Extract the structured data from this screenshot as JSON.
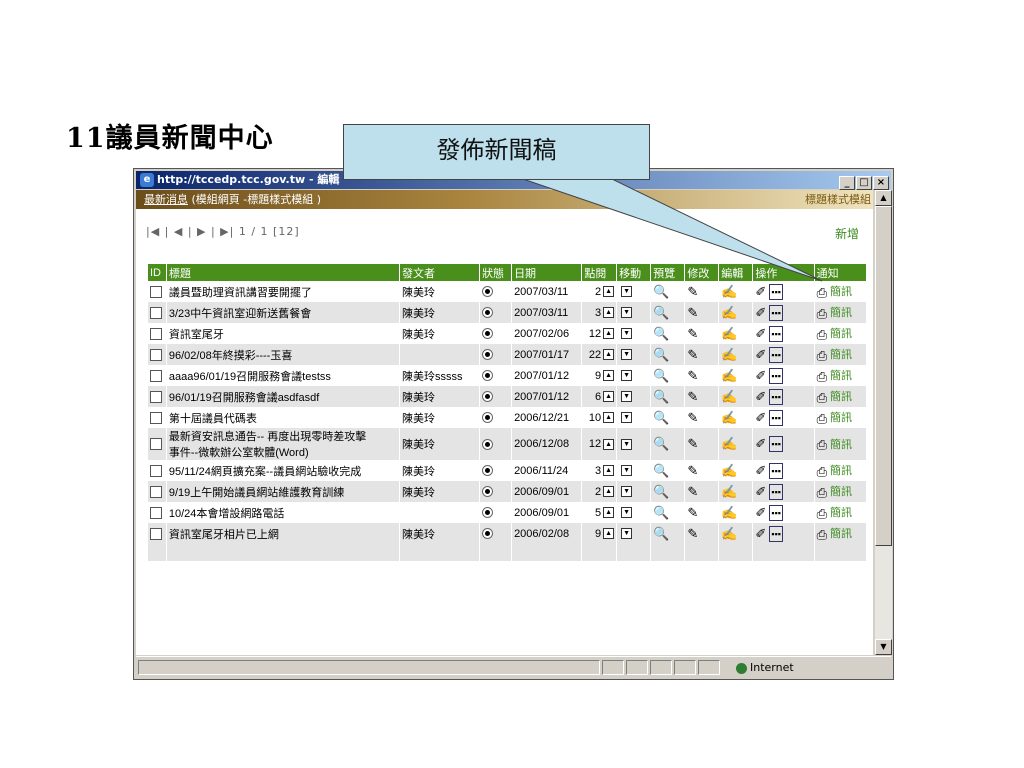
{
  "slide": {
    "title": "11議員新聞中心",
    "callout": "發佈新聞稿"
  },
  "window": {
    "title": "http://tccedp.tcc.gov.tw - 編輯",
    "ie_icon": "e",
    "buttons": [
      "_",
      "□",
      "×"
    ]
  },
  "banner": {
    "link": "最新消息",
    "subtitle": "(模組網頁 -標題樣式模組 )",
    "right": "標題樣式模組"
  },
  "toolbar": {
    "pager": "|◀ | ◀ | ▶ | ▶|   1 / 1  [12]",
    "add_label": "新增"
  },
  "table": {
    "headers": [
      "ID",
      "標題",
      "發文者",
      "狀態",
      "日期",
      "點閱",
      "移動",
      "預覽",
      "修改",
      "編輯",
      "操作",
      "通知"
    ],
    "sms_label": "簡訊",
    "rows": [
      {
        "title": "議員暨助理資訊講習要開擺了",
        "author": "陳美玲",
        "date": "2007/03/11",
        "clicks": "2"
      },
      {
        "title": "3/23中午資訊室迎新送舊餐會",
        "author": "陳美玲",
        "date": "2007/03/11",
        "clicks": "3"
      },
      {
        "title": "資訊室尾牙",
        "author": "陳美玲",
        "date": "2007/02/06",
        "clicks": "12"
      },
      {
        "title": "96/02/08年終摸彩----玉喜",
        "author": "",
        "date": "2007/01/17",
        "clicks": "22"
      },
      {
        "title": "aaaa96/01/19召開服務會議testss",
        "author": "陳美玲sssss",
        "date": "2007/01/12",
        "clicks": "9"
      },
      {
        "title": "96/01/19召開服務會議asdfasdf",
        "author": "陳美玲",
        "date": "2007/01/12",
        "clicks": "6"
      },
      {
        "title": "第十屆議員代碼表",
        "author": "陳美玲",
        "date": "2006/12/21",
        "clicks": "10"
      },
      {
        "title": "最新資安訊息通告-- 再度出現零時差攻擊",
        "title2": "事件--微軟辦公室軟體(Word)",
        "author": "陳美玲",
        "date": "2006/12/08",
        "clicks": "12"
      },
      {
        "title": "95/11/24網頁擴充案--議員網站驗收完成",
        "author": "陳美玲",
        "date": "2006/11/24",
        "clicks": "3"
      },
      {
        "title": "9/19上午開始議員網站維護教育訓練",
        "author": "陳美玲",
        "date": "2006/09/01",
        "clicks": "2"
      },
      {
        "title": "10/24本會增設網路電話",
        "author": "",
        "date": "2006/09/01",
        "clicks": "5"
      },
      {
        "title": "資訊室尾牙相片已上網",
        "author": "陳美玲",
        "date": "2006/02/08",
        "clicks": "9"
      }
    ]
  },
  "statusbar": {
    "zone": "Internet"
  }
}
